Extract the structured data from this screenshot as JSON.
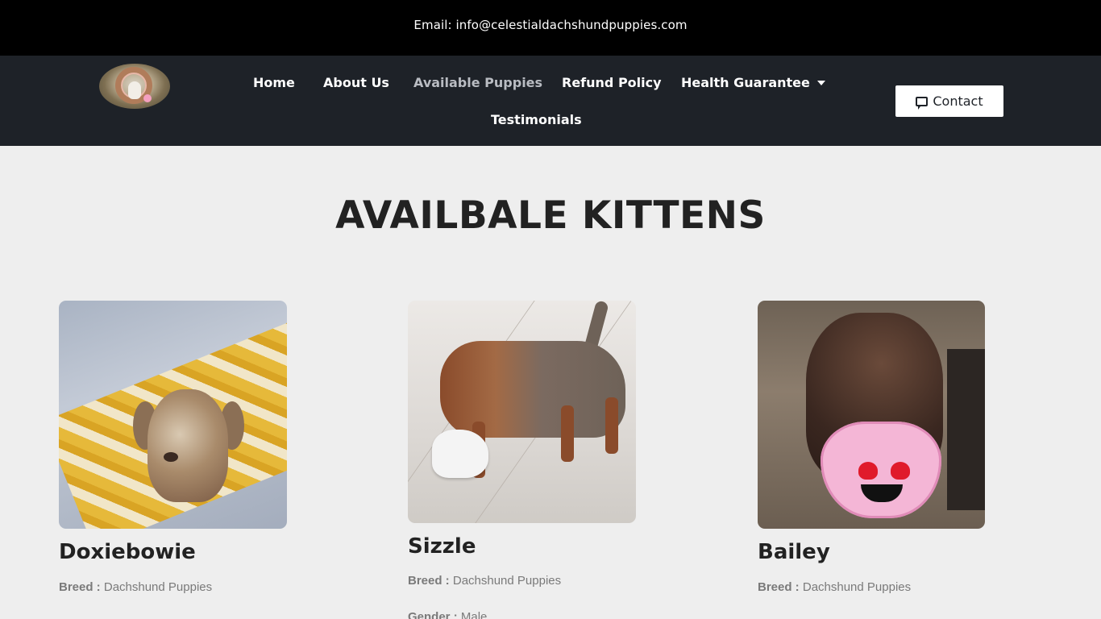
{
  "topbar": {
    "email": "Email: info@celestialdachshundpuppies.com"
  },
  "nav": {
    "items": [
      {
        "label": "Home"
      },
      {
        "label": "About Us"
      },
      {
        "label": "Available Puppies"
      },
      {
        "label": "Refund Policy"
      },
      {
        "label": "Health Guarantee"
      },
      {
        "label": "Testimonials"
      }
    ],
    "contact_label": "Contact"
  },
  "main": {
    "title": "AVAILBALE KITTENS",
    "cards": [
      {
        "name": "Doxiebowie",
        "breed_label": "Breed :",
        "breed_value": "Dachshund Puppies"
      },
      {
        "name": "Sizzle",
        "breed_label": "Breed :",
        "breed_value": "Dachshund Puppies",
        "gender_label": "Gender :",
        "gender_value": "Male"
      },
      {
        "name": "Bailey",
        "breed_label": "Breed :",
        "breed_value": "Dachshund Puppies"
      }
    ]
  },
  "colors": {
    "topbar": "#000000",
    "navbar": "#1e2228",
    "background": "#eeeeee",
    "active_nav": "#b9bcc2"
  }
}
